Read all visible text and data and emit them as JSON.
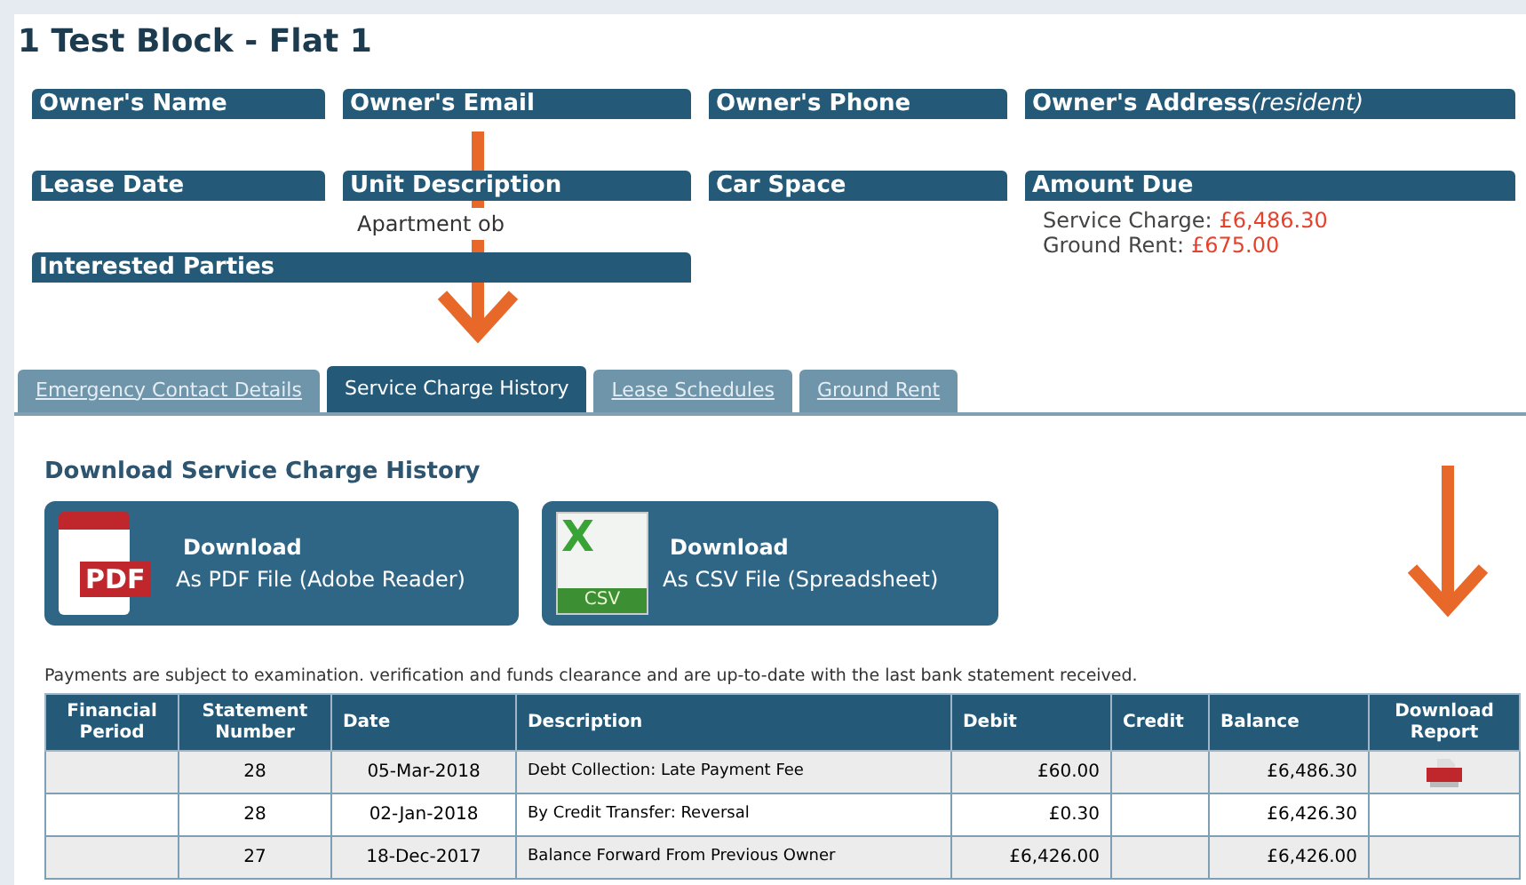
{
  "title": "1 Test Block - Flat 1",
  "fields": [
    {
      "label": "Owner's Name"
    },
    {
      "label": "Owner's Email"
    },
    {
      "label": "Owner's Phone"
    },
    {
      "label": "Owner's Address",
      "note": "(resident)"
    },
    {
      "label": "Lease Date"
    },
    {
      "label": "Unit Description",
      "value": "Apartment ob"
    },
    {
      "label": "Car Space"
    },
    {
      "label": "Amount Due",
      "amounts": [
        {
          "label": "Service Charge:",
          "value": "£6,486.30"
        },
        {
          "label": "Ground Rent:",
          "value": "£675.00"
        }
      ]
    }
  ],
  "interested_parties": {
    "label": "Interested Parties"
  },
  "tabs": [
    {
      "label": "Emergency Contact Details",
      "selected": false
    },
    {
      "label": "Service Charge History",
      "selected": true
    },
    {
      "label": "Lease Schedules",
      "selected": false
    },
    {
      "label": "Ground Rent",
      "selected": false
    }
  ],
  "section_title": "Download Service Charge History",
  "downloads": [
    {
      "kind": "pdf",
      "title": "Download",
      "subtitle": "As PDF File (Adobe Reader)",
      "badge": "PDF"
    },
    {
      "kind": "csv",
      "title": "Download",
      "subtitle": "As CSV File (Spreadsheet)",
      "badge": "CSV",
      "letter": "X"
    }
  ],
  "notice": "Payments are subject to examination. verification and funds clearance and are up-to-date with the last bank statement received.",
  "table": {
    "columns": [
      "Financial Period",
      "Statement Number",
      "Date",
      "Description",
      "Debit",
      "Credit",
      "Balance",
      "Download Report"
    ],
    "rows": [
      {
        "statement": "28",
        "date": "05-Mar-2018",
        "description": "Debt Collection: Late Payment Fee",
        "debit": "£60.00",
        "balance": "£6,486.30",
        "report": true
      },
      {
        "statement": "28",
        "date": "02-Jan-2018",
        "description": "By Credit Transfer: Reversal",
        "debit": "£0.30",
        "balance": "£6,426.30",
        "report": false
      },
      {
        "statement": "27",
        "date": "18-Dec-2017",
        "description": "Balance Forward From Previous Owner",
        "debit": "£6,426.00",
        "balance": "£6,426.00",
        "report": false
      }
    ]
  }
}
